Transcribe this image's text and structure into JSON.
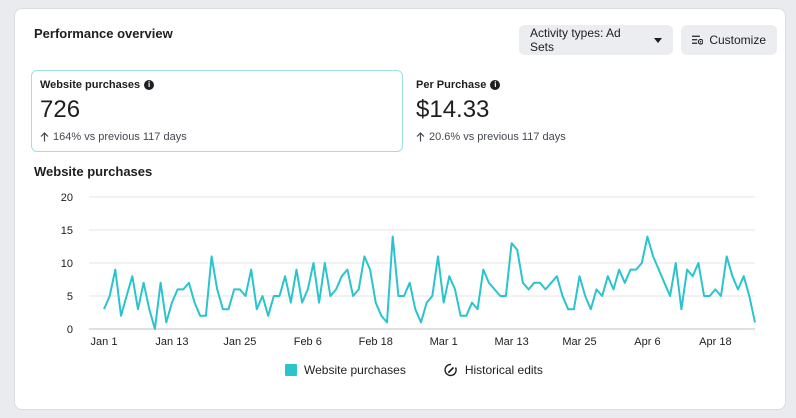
{
  "header": {
    "title": "Performance overview",
    "activity_button": "Activity types: Ad Sets",
    "customize_button": "Customize"
  },
  "metrics": [
    {
      "label": "Website purchases",
      "value": "726",
      "change": "164% vs previous 117 days",
      "selected": true
    },
    {
      "label": "Per Purchase",
      "value": "$14.33",
      "change": "20.6% vs previous 117 days",
      "selected": false
    }
  ],
  "chart_section_title": "Website purchases",
  "legend": {
    "series_label": "Website purchases",
    "edits_label": "Historical edits"
  },
  "colors": {
    "series": "#2bc4cc",
    "selected_border": "#9fdfe6",
    "grid": "#e4e6eb"
  },
  "chart_data": {
    "type": "line",
    "x_start": "Jan 1",
    "x_end": "Apr 28",
    "x_ticks": [
      "Jan 1",
      "Jan 13",
      "Jan 25",
      "Feb 6",
      "Feb 18",
      "Mar 1",
      "Mar 13",
      "Mar 25",
      "Apr 6",
      "Apr 18"
    ],
    "y_ticks": [
      0,
      5,
      10,
      15,
      20
    ],
    "ylim": [
      0,
      20
    ],
    "grid": true,
    "series": [
      {
        "name": "Website purchases",
        "values": [
          3,
          5,
          9,
          2,
          5,
          8,
          3,
          7,
          3,
          0,
          7,
          1,
          4,
          6,
          6,
          7,
          4,
          2,
          2,
          11,
          6,
          3,
          3,
          6,
          6,
          5,
          9,
          3,
          5,
          2,
          5,
          5,
          8,
          4,
          9,
          4,
          6,
          10,
          4,
          10,
          5,
          6,
          8,
          9,
          5,
          6,
          11,
          9,
          4,
          2,
          1,
          14,
          5,
          5,
          7,
          3,
          1,
          4,
          5,
          11,
          4,
          8,
          6,
          2,
          2,
          4,
          3,
          9,
          7,
          6,
          5,
          5,
          13,
          12,
          7,
          6,
          7,
          7,
          6,
          7,
          8,
          5,
          3,
          3,
          8,
          5,
          3,
          6,
          5,
          8,
          6,
          9,
          7,
          9,
          9,
          10,
          14,
          11,
          9,
          7,
          5,
          10,
          3,
          9,
          8,
          10,
          5,
          5,
          6,
          5,
          11,
          8,
          6,
          8,
          5,
          1
        ]
      }
    ]
  }
}
